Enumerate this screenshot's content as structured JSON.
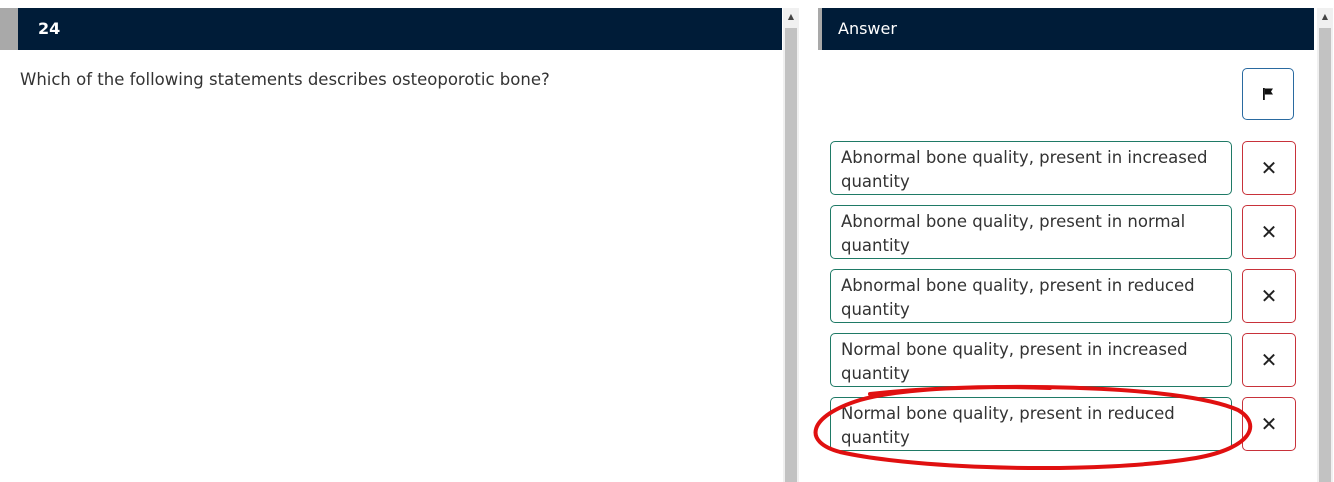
{
  "question": {
    "number": "24",
    "text": "Which of the following statements describes osteoporotic bone?"
  },
  "answer_panel": {
    "title": "Answer",
    "flag_icon": "flag-icon",
    "options": [
      {
        "label": "Abnormal bone quality, present in increased quantity",
        "strike_icon": "close-icon"
      },
      {
        "label": "Abnormal bone quality, present in normal quantity",
        "strike_icon": "close-icon"
      },
      {
        "label": "Abnormal bone quality, present in reduced quantity",
        "strike_icon": "close-icon"
      },
      {
        "label": "Normal bone quality, present in increased quantity",
        "strike_icon": "close-icon"
      },
      {
        "label": "Normal bone quality, present in reduced quantity",
        "strike_icon": "close-icon"
      }
    ],
    "x_glyph": "✕",
    "highlighted_option_index": 4
  },
  "colors": {
    "header_bg": "#001c38",
    "option_border": "#1f7a66",
    "strike_border": "#c8323a",
    "flag_border": "#2a6aa0",
    "annotation": "#e01010"
  },
  "scroll_arrow_glyph": "▲"
}
